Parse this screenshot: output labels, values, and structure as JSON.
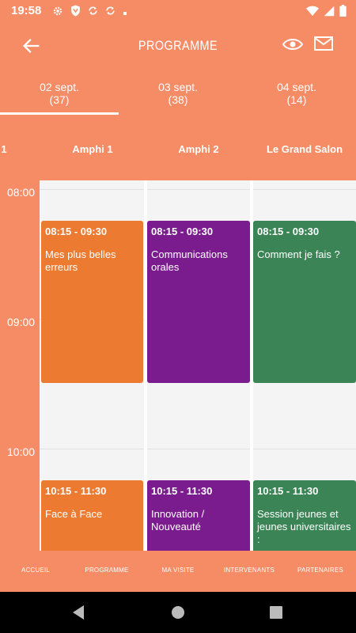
{
  "status_bar": {
    "time": "19:58"
  },
  "app_bar": {
    "title": "PROGRAMME"
  },
  "date_tabs": [
    {
      "date": "02 sept.",
      "count": "(37)"
    },
    {
      "date": "03 sept.",
      "count": "(38)"
    },
    {
      "date": "04 sept.",
      "count": "(14)"
    }
  ],
  "rooms": {
    "partial": "1",
    "r1": "Amphi 1",
    "r2": "Amphi 2",
    "r3": "Le Grand Salon"
  },
  "times": [
    "08:00",
    "09:00",
    "10:00"
  ],
  "sessions": [
    {
      "time": "08:15 - 09:30",
      "title": "Mes plus belles erreurs"
    },
    {
      "time": "08:15 - 09:30",
      "title": "Communications orales"
    },
    {
      "time": "08:15 - 09:30",
      "title": "Comment je fais ?"
    },
    {
      "time": "10:15 - 11:30",
      "title": "Face à Face"
    },
    {
      "time": "10:15 - 11:30",
      "title": "Innovation / Nouveauté"
    },
    {
      "time": "10:15 - 11:30",
      "title": "Session jeunes et jeunes universitaires :"
    }
  ],
  "bottom_nav": [
    "ACCUEIL",
    "PROGRAMME",
    "MA VISITE",
    "INTERVENANTS",
    "PARTENAIRES"
  ],
  "colors": {
    "accent": "#f58c66",
    "orange": "#ec7a30",
    "purple": "#7b1c8e",
    "green": "#3a8456"
  },
  "icons": [
    "settings-icon",
    "shield-icon",
    "sync-icon",
    "wifi-icon",
    "signal-icon",
    "battery-icon",
    "back-arrow-icon",
    "eye-icon",
    "mail-icon"
  ]
}
